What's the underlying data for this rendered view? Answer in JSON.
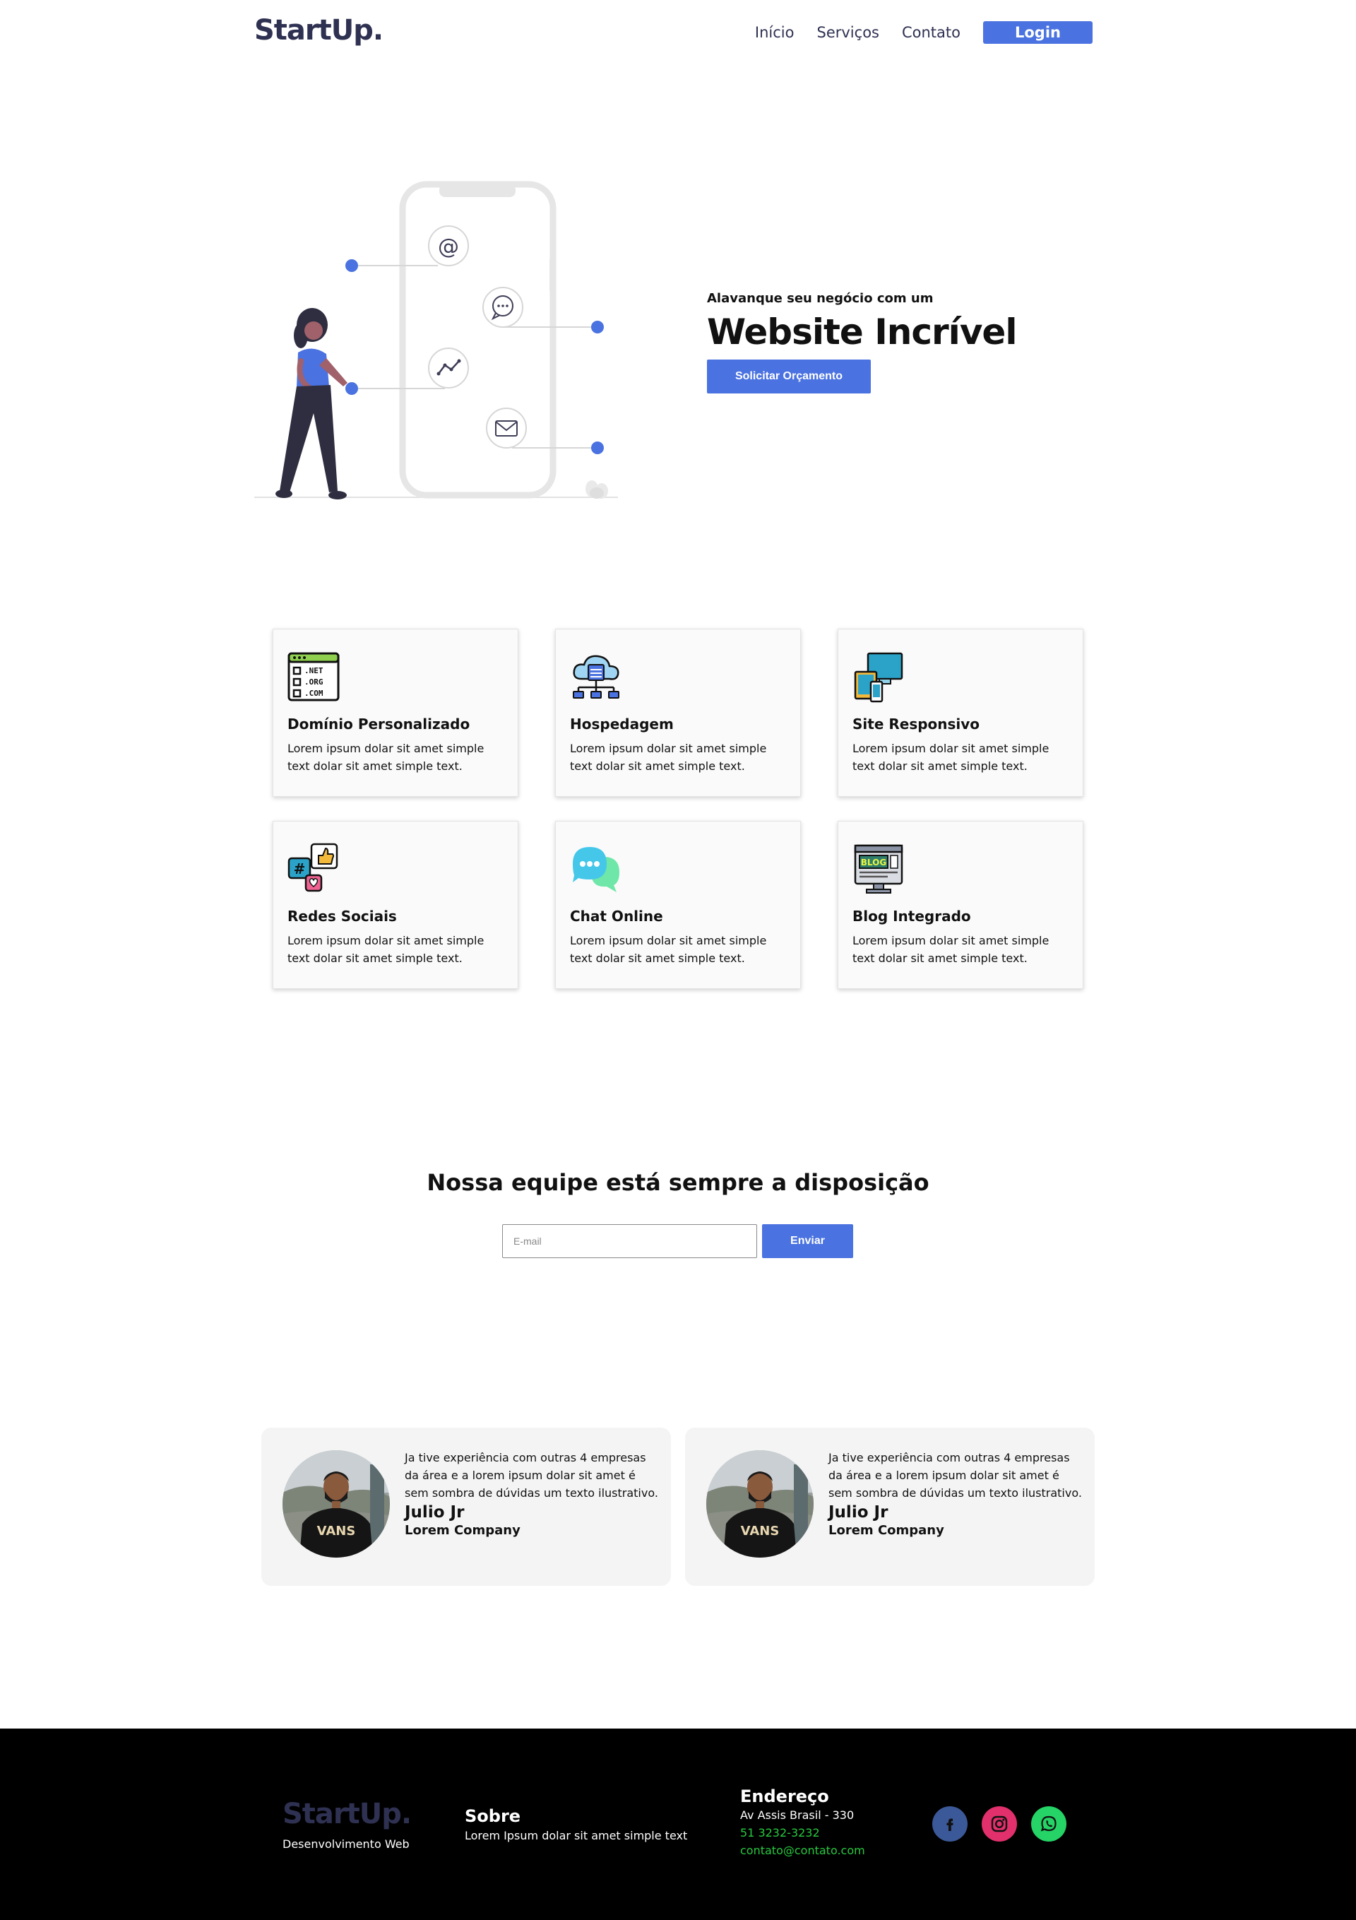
{
  "header": {
    "logo": "StartUp.",
    "nav": [
      "Início",
      "Serviços",
      "Contato"
    ],
    "login_label": "Login"
  },
  "hero": {
    "subtitle": "Alavanque seu negócio com um",
    "title": "Website Incrível",
    "cta_label": "Solicitar Orçamento"
  },
  "services": [
    {
      "icon": "domain-icon",
      "title": "Domínio Personalizado",
      "text": "Lorem ipsum dolar sit amet simple text dolar sit amet simple text."
    },
    {
      "icon": "cloud-server-icon",
      "title": "Hospedagem",
      "text": "Lorem ipsum dolar sit amet simple text dolar sit amet simple text."
    },
    {
      "icon": "responsive-devices-icon",
      "title": "Site Responsivo",
      "text": "Lorem ipsum dolar sit amet simple text dolar sit amet simple text."
    },
    {
      "icon": "social-media-icon",
      "title": "Redes Sociais",
      "text": "Lorem ipsum dolar sit amet simple text dolar sit amet simple text."
    },
    {
      "icon": "chat-bubbles-icon",
      "title": "Chat Online",
      "text": "Lorem ipsum dolar sit amet simple text dolar sit amet simple text."
    },
    {
      "icon": "blog-icon",
      "title": "Blog Integrado",
      "text": "Lorem ipsum dolar sit amet simple text dolar sit amet simple text."
    }
  ],
  "newsletter": {
    "title": "Nossa equipe está sempre a disposição",
    "placeholder": "E-mail",
    "button_label": "Enviar"
  },
  "testimonials": [
    {
      "quote": "Ja tive experiência com outras 4 empresas da área e a lorem ipsum dolar sit amet é sem sombra de dúvidas um texto ilustrativo.",
      "name": "Julio Jr",
      "company": "Lorem Company"
    },
    {
      "quote": "Ja tive experiência com outras 4 empresas da área e a lorem ipsum dolar sit amet é sem sombra de dúvidas um texto ilustrativo.",
      "name": "Julio Jr",
      "company": "Lorem Company"
    }
  ],
  "footer": {
    "logo": "StartUp.",
    "tagline": "Desenvolvimento Web",
    "about_title": "Sobre",
    "about_text": "Lorem Ipsum dolar sit amet simple text",
    "address_title": "Endereço",
    "address_line": "Av Assis Brasil - 330",
    "phone": "51 3232-3232",
    "email": "contato@contato.com",
    "socials": [
      {
        "icon": "facebook-icon",
        "color": "#3b5998"
      },
      {
        "icon": "instagram-icon",
        "color": "#e1306c"
      },
      {
        "icon": "whatsapp-icon",
        "color": "#25d366"
      }
    ]
  },
  "colors": {
    "accent": "#4a72e0",
    "brand_dark": "#2f3152",
    "footer_bg": "#000000",
    "footer_link": "#27c93f"
  }
}
